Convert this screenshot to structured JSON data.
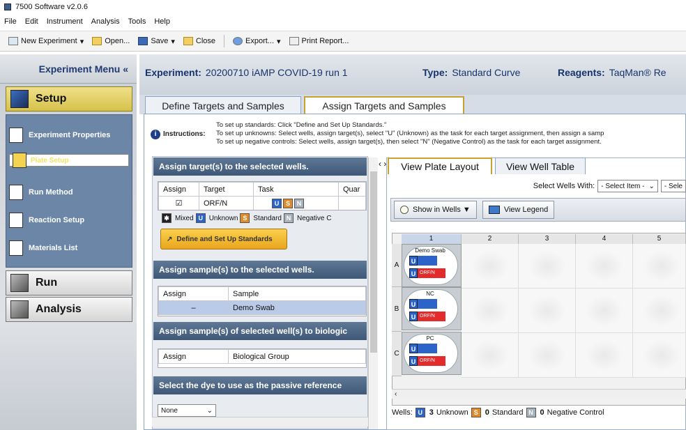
{
  "window": {
    "title": "7500 Software v2.0.6"
  },
  "menu": [
    "File",
    "Edit",
    "Instrument",
    "Analysis",
    "Tools",
    "Help"
  ],
  "toolbar": {
    "new_experiment": "New Experiment",
    "open": "Open...",
    "save": "Save",
    "close": "Close",
    "export": "Export...",
    "print_report": "Print Report..."
  },
  "sidebar": {
    "header": "Experiment Menu «",
    "setup": "Setup",
    "items": [
      "Experiment Properties",
      "Plate Setup",
      "Run Method",
      "Reaction Setup",
      "Materials List"
    ],
    "selected_item": "Plate Setup",
    "run": "Run",
    "analysis": "Analysis"
  },
  "experiment": {
    "label": "Experiment:",
    "name": "20200710 iAMP COVID-19 run 1",
    "type_label": "Type:",
    "type": "Standard Curve",
    "reagents_label": "Reagents:",
    "reagents": "TaqMan® Re"
  },
  "tabs": [
    "Define Targets and Samples",
    "Assign Targets and Samples"
  ],
  "active_tab": "Assign Targets and Samples",
  "instructions": {
    "label": "Instructions:",
    "line1": "To set up standards: Click \"Define and Set Up Standards.\"",
    "line2": "To set up unknowns: Select wells, assign target(s), select \"U\" (Unknown) as the task for each target assignment, then assign a samp",
    "line3": "To set up negative controls: Select wells, assign target(s), then select \"N\" (Negative Control) as the task for each target assignment."
  },
  "assign_targets": {
    "header": "Assign target(s) to the selected wells.",
    "columns": [
      "Assign",
      "Target",
      "Task",
      "Quar"
    ],
    "row": {
      "assign": "☑",
      "target": "ORF/N"
    },
    "legend": {
      "mixed": "Mixed",
      "unknown": "Unknown",
      "standard": "Standard",
      "negative": "Negative C"
    },
    "define_button": "Define and Set Up Standards"
  },
  "assign_samples": {
    "header": "Assign sample(s) to the selected wells.",
    "columns": [
      "Assign",
      "Sample"
    ],
    "row": {
      "assign": "–",
      "sample": "Demo Swab"
    }
  },
  "bio_group": {
    "header": "Assign sample(s) of selected well(s) to biologic",
    "columns": [
      "Assign",
      "Biological Group"
    ]
  },
  "passive_ref": {
    "header": "Select the dye to use as the passive reference",
    "value": "None"
  },
  "right_tabs": [
    "View Plate Layout",
    "View Well Table"
  ],
  "select_wells": {
    "label": "Select Wells With:",
    "option1": "- Select Item -",
    "option2": "- Sele"
  },
  "plate_buttons": {
    "show_in_wells": "Show in Wells ▼",
    "view_legend": "View Legend"
  },
  "plate": {
    "columns": [
      "1",
      "2",
      "3",
      "4",
      "5"
    ],
    "rows": [
      "A",
      "B",
      "C"
    ],
    "wells": [
      {
        "row": "A",
        "sample": "Demo Swab",
        "task": "U",
        "target": "ORF/N"
      },
      {
        "row": "B",
        "sample": "NC",
        "task": "U",
        "target": "ORF/N"
      },
      {
        "row": "C",
        "sample": "PC",
        "task": "U",
        "target": "ORF/N"
      }
    ]
  },
  "footer": {
    "label": "Wells:",
    "unknown_count": "3",
    "unknown_label": "Unknown",
    "standard_count": "0",
    "standard_label": "Standard",
    "negative_count": "0",
    "negative_label": "Negative Control"
  }
}
